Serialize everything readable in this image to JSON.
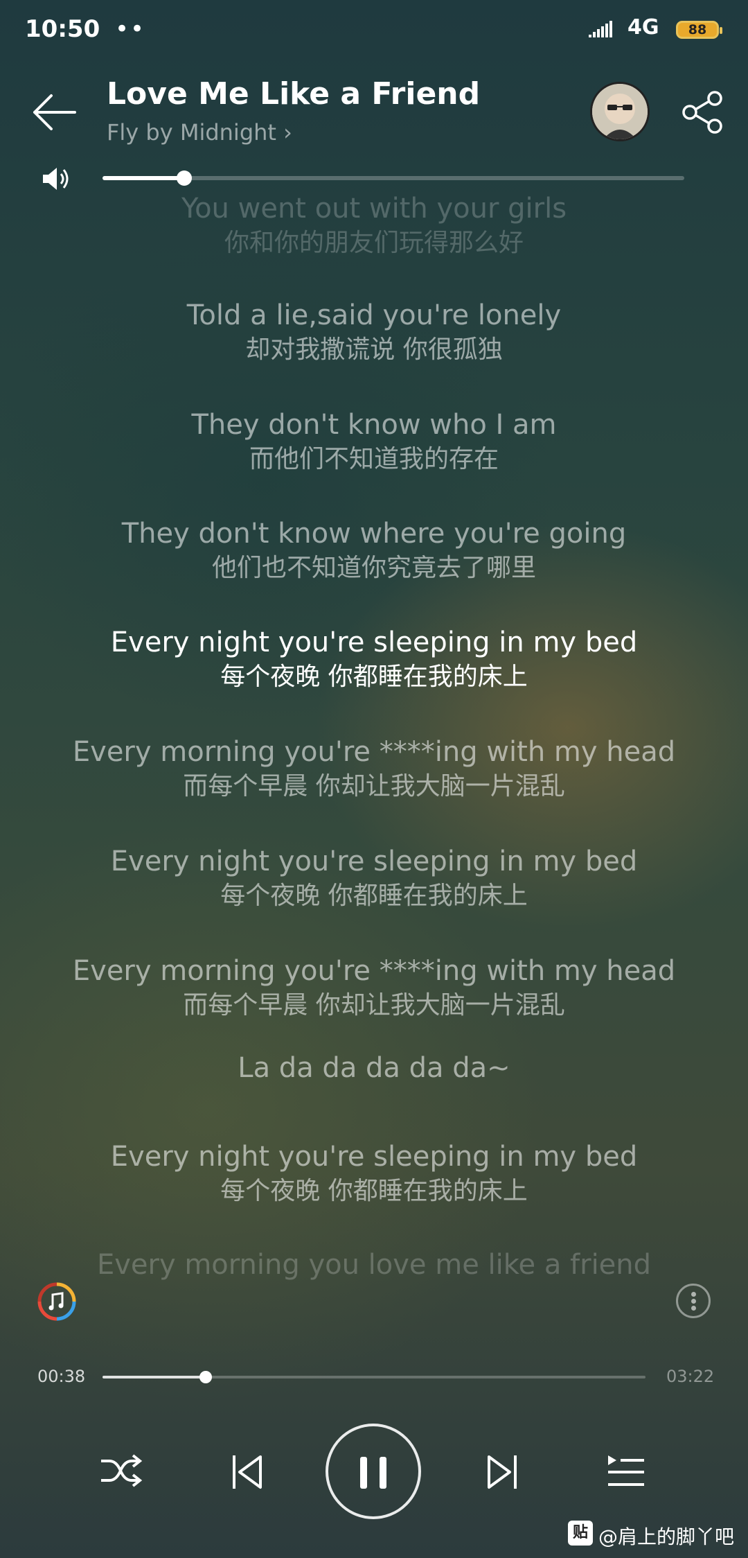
{
  "status_bar": {
    "time": "10:50",
    "dots": "••",
    "network": "4G",
    "battery": "88"
  },
  "song": {
    "title": "Love Me Like a Friend",
    "artist": "Fly by Midnight",
    "artist_chevron": "›"
  },
  "volume": {
    "level": 0.14
  },
  "lyrics": [
    {
      "en": "You went out with your girls",
      "zh": "你和你的朋友们玩得那么好",
      "state": "faded"
    },
    {
      "en": "Told a lie,said you're lonely",
      "zh": "却对我撒谎说 你很孤独",
      "state": "normal"
    },
    {
      "en": "They don't know who I am",
      "zh": "而他们不知道我的存在",
      "state": "normal"
    },
    {
      "en": "They don't know where you're going",
      "zh": "他们也不知道你究竟去了哪里",
      "state": "normal"
    },
    {
      "en": "Every night you're sleeping in my bed",
      "zh": "每个夜晚 你都睡在我的床上",
      "state": "active"
    },
    {
      "en": "Every morning you're ****ing with my head",
      "zh": "而每个早晨 你却让我大脑一片混乱",
      "state": "normal"
    },
    {
      "en": "Every night you're sleeping in my bed",
      "zh": "每个夜晚 你都睡在我的床上",
      "state": "normal"
    },
    {
      "en": "Every morning you're ****ing with my head",
      "zh": "而每个早晨 你却让我大脑一片混乱",
      "state": "normal"
    },
    {
      "en": "La da da da da da~",
      "zh": "",
      "state": "normal"
    },
    {
      "en": "Every night you're sleeping in my bed",
      "zh": "每个夜晚 你都睡在我的床上",
      "state": "normal"
    },
    {
      "en": "Every morning you love me like a friend",
      "zh": "",
      "state": "faded"
    }
  ],
  "playback": {
    "current_time": "00:38",
    "total_time": "03:22",
    "progress": 0.19
  },
  "icons": {
    "back": "back-arrow-icon",
    "share": "share-icon",
    "volume": "speaker-icon",
    "music": "music-note-icon",
    "more": "more-vertical-icon",
    "shuffle": "shuffle-icon",
    "previous": "previous-track-icon",
    "pause": "pause-icon",
    "next": "next-track-icon",
    "playlist": "playlist-icon"
  },
  "watermark": {
    "badge": "贴",
    "text": "@肩上的脚丫吧"
  }
}
